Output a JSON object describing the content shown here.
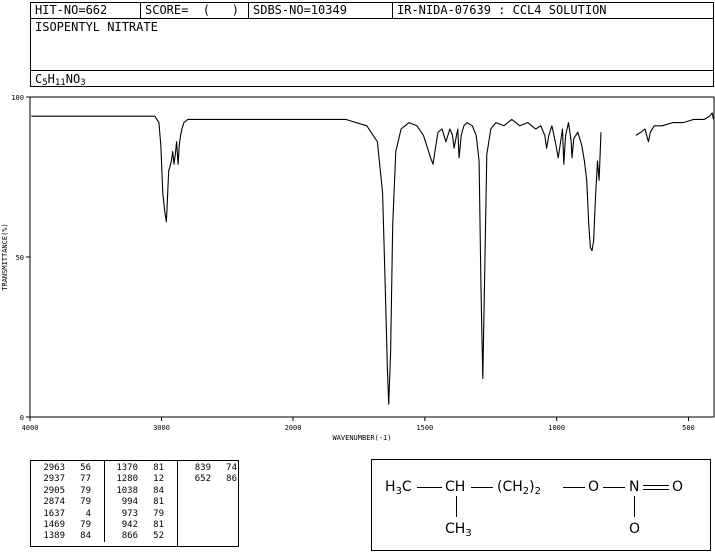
{
  "header": {
    "hit_no": "HIT-NO=662",
    "score": "SCORE=  (   )",
    "sdbs_no": "SDBS-NO=10349",
    "ir_info": "IR-NIDA-07639 : CCL4 SOLUTION",
    "compound_name": "ISOPENTYL NITRATE",
    "formula": {
      "C": "C",
      "c_sub": "5",
      "H": "H",
      "h_sub": "11",
      "N": "N",
      "O": "O",
      "o_sub": "3"
    }
  },
  "chart_data": {
    "type": "line",
    "xlabel": "WAVENUMBER(-1)",
    "ylabel": "TRANSMITTANCE(%)",
    "xlim": [
      4000,
      400
    ],
    "ylim": [
      0,
      100
    ],
    "x_ticks": [
      "4000",
      "3000",
      "2000",
      "1500",
      "1000",
      "500"
    ],
    "x_tick_values": [
      4000,
      3000,
      2000,
      1500,
      1000,
      500
    ],
    "y_ticks": [
      "100",
      "50",
      "0"
    ],
    "y_tick_values": [
      100,
      50,
      0
    ],
    "x_axis_break": 2000,
    "series": [
      {
        "x": [
          3990,
          3700,
          3200,
          3050,
          3020,
          3005,
          2990,
          2975,
          2963,
          2955,
          2945,
          2937,
          2925,
          2915,
          2905,
          2895,
          2885,
          2874,
          2865,
          2855,
          2845,
          2830,
          2800,
          2700,
          2500,
          2200,
          2000,
          1900,
          1800,
          1720,
          1680,
          1660,
          1650,
          1642,
          1637,
          1630,
          1622,
          1610,
          1590,
          1560,
          1530,
          1505,
          1490,
          1478,
          1469,
          1460,
          1450,
          1435,
          1420,
          1405,
          1395,
          1389,
          1380,
          1375,
          1370,
          1362,
          1352,
          1340,
          1320,
          1305,
          1294,
          1287,
          1280,
          1273,
          1265,
          1250,
          1230,
          1200,
          1170,
          1140,
          1110,
          1080,
          1060,
          1045,
          1038,
          1030,
          1018,
          1005,
          994,
          985,
          978,
          973,
          966,
          955,
          945,
          942,
          935,
          920,
          905,
          895,
          886,
          878,
          872,
          866,
          860,
          852,
          845,
          839,
          832
        ],
        "y": [
          94,
          94,
          94,
          94,
          92,
          85,
          70,
          64,
          61,
          68,
          77,
          78,
          80,
          83,
          79,
          82,
          86,
          79,
          85,
          88,
          90,
          92,
          93,
          93,
          93,
          93,
          93,
          93,
          93,
          91,
          86,
          70,
          40,
          15,
          4,
          20,
          60,
          83,
          90,
          92,
          91,
          88,
          84,
          81,
          79,
          84,
          89,
          90,
          86,
          90,
          88,
          84,
          88,
          90,
          81,
          88,
          91,
          92,
          91,
          88,
          80,
          40,
          12,
          45,
          82,
          90,
          92,
          91,
          93,
          91,
          92,
          90,
          91,
          88,
          84,
          88,
          91,
          86,
          81,
          86,
          90,
          79,
          88,
          92,
          86,
          81,
          87,
          89,
          85,
          80,
          74,
          60,
          53,
          52,
          55,
          70,
          80,
          74,
          89
        ]
      },
      {
        "x": [
          700,
          680,
          665,
          652,
          645,
          630,
          600,
          560,
          520,
          480,
          440,
          420,
          410,
          405
        ],
        "y": [
          88,
          89,
          90,
          86,
          89,
          91,
          91,
          92,
          92,
          93,
          93,
          94,
          95,
          93
        ]
      }
    ]
  },
  "peak_table": {
    "columns": [
      [
        {
          "w": "2963",
          "t": "56"
        },
        {
          "w": "2937",
          "t": "77"
        },
        {
          "w": "2905",
          "t": "79"
        },
        {
          "w": "2874",
          "t": "79"
        },
        {
          "w": "1637",
          "t": "4"
        },
        {
          "w": "1469",
          "t": "79"
        },
        {
          "w": "1389",
          "t": "84"
        }
      ],
      [
        {
          "w": "1370",
          "t": "81"
        },
        {
          "w": "1280",
          "t": "12"
        },
        {
          "w": "1038",
          "t": "84"
        },
        {
          "w": "994",
          "t": "81"
        },
        {
          "w": "973",
          "t": "79"
        },
        {
          "w": "942",
          "t": "81"
        },
        {
          "w": "866",
          "t": "52"
        }
      ],
      [
        {
          "w": "839",
          "t": "74"
        },
        {
          "w": "652",
          "t": "86"
        }
      ]
    ]
  },
  "structure": {
    "h3c": "H",
    "h3c_sub": "3",
    "h3c_c": "C",
    "ch": "CH",
    "ch2_open": "(CH",
    "ch2_sub": "2",
    "ch2_close": ")",
    "ch2_n": "2",
    "o": "O",
    "n": "N",
    "o_double": "O",
    "o_below": "O",
    "ch3": "CH",
    "ch3_sub": "3"
  }
}
